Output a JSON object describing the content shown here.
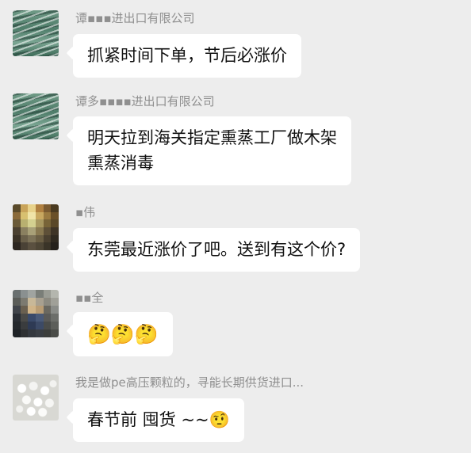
{
  "messages": [
    {
      "sender": "谭▪▪▪进出口有限公司",
      "text": "抓紧时间下单，节后必涨价",
      "avatar": "scaffold-photo"
    },
    {
      "sender": "谭多▪▪▪▪进出口有限公司",
      "text": "明天拉到海关指定熏蒸工厂做木架\n熏蒸消毒",
      "avatar": "scaffold-photo"
    },
    {
      "sender": "▪伟",
      "text": "东莞最近涨价了吧。送到有这个价?",
      "avatar": "pixelated-photo"
    },
    {
      "sender": "▪▪全",
      "text": "🤔🤔🤔",
      "avatar": "pixelated-photo"
    },
    {
      "sender": "我是做pe高压颗粒的，寻能长期供货进口...",
      "text": "春节前 囤货 ~~🤨",
      "avatar": "plastic-pellets-photo"
    }
  ],
  "colors": {
    "background": "#ededed",
    "bubble": "#ffffff",
    "sender_text": "#8f8f8f",
    "message_text": "#111111"
  }
}
